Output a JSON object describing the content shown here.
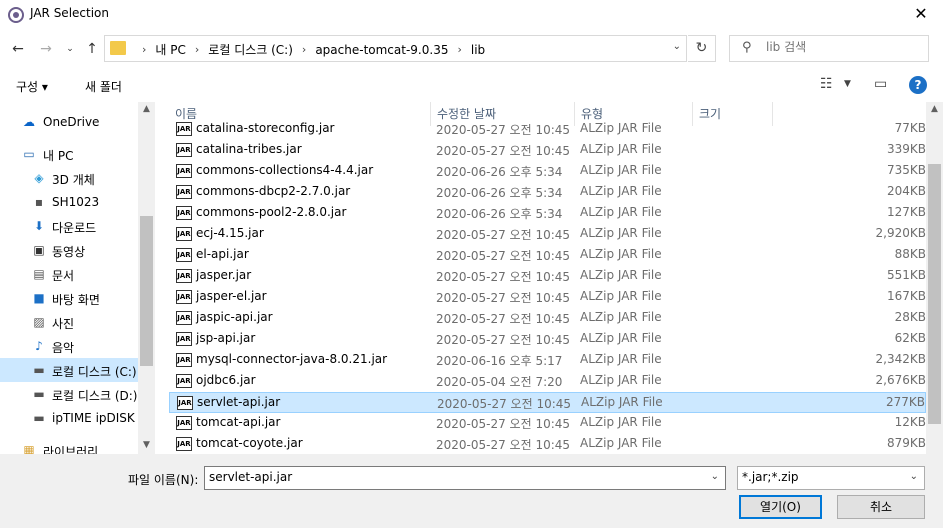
{
  "window": {
    "title": "JAR Selection"
  },
  "address": {
    "crumbs": [
      "내 PC",
      "로컬 디스크 (C:)",
      "apache-tomcat-9.0.35",
      "lib"
    ]
  },
  "search": {
    "placeholder": "lib 검색"
  },
  "toolbar": {
    "organize": "구성 ▾",
    "new_folder": "새 폴더"
  },
  "sidebar": {
    "items": [
      {
        "label": "OneDrive",
        "icon": "cloud-icon"
      },
      {
        "label": "내 PC",
        "icon": "computer-icon"
      },
      {
        "label": "3D 개체",
        "icon": "cube-icon"
      },
      {
        "label": "SH1023",
        "icon": "device-icon"
      },
      {
        "label": "다운로드",
        "icon": "download-icon"
      },
      {
        "label": "동영상",
        "icon": "video-icon"
      },
      {
        "label": "문서",
        "icon": "document-icon"
      },
      {
        "label": "바탕 화면",
        "icon": "desktop-icon"
      },
      {
        "label": "사진",
        "icon": "pictures-icon"
      },
      {
        "label": "음악",
        "icon": "music-icon"
      },
      {
        "label": "로컬 디스크 (C:)",
        "icon": "drive-icon"
      },
      {
        "label": "로컬 디스크 (D:)",
        "icon": "drive-icon"
      },
      {
        "label": "ipTIME ipDISK D",
        "icon": "drive-icon"
      },
      {
        "label": "라이브러리",
        "icon": "library-icon"
      }
    ]
  },
  "columns": {
    "name": "이름",
    "date": "수정한 날짜",
    "type": "유형",
    "size": "크기"
  },
  "files": [
    {
      "name": "catalina-storeconfig.jar",
      "date": "2020-05-27 오전 10:45",
      "type": "ALZip JAR File",
      "size": "77KB"
    },
    {
      "name": "catalina-tribes.jar",
      "date": "2020-05-27 오전 10:45",
      "type": "ALZip JAR File",
      "size": "339KB"
    },
    {
      "name": "commons-collections4-4.4.jar",
      "date": "2020-06-26 오후 5:34",
      "type": "ALZip JAR File",
      "size": "735KB"
    },
    {
      "name": "commons-dbcp2-2.7.0.jar",
      "date": "2020-06-26 오후 5:34",
      "type": "ALZip JAR File",
      "size": "204KB"
    },
    {
      "name": "commons-pool2-2.8.0.jar",
      "date": "2020-06-26 오후 5:34",
      "type": "ALZip JAR File",
      "size": "127KB"
    },
    {
      "name": "ecj-4.15.jar",
      "date": "2020-05-27 오전 10:45",
      "type": "ALZip JAR File",
      "size": "2,920KB"
    },
    {
      "name": "el-api.jar",
      "date": "2020-05-27 오전 10:45",
      "type": "ALZip JAR File",
      "size": "88KB"
    },
    {
      "name": "jasper.jar",
      "date": "2020-05-27 오전 10:45",
      "type": "ALZip JAR File",
      "size": "551KB"
    },
    {
      "name": "jasper-el.jar",
      "date": "2020-05-27 오전 10:45",
      "type": "ALZip JAR File",
      "size": "167KB"
    },
    {
      "name": "jaspic-api.jar",
      "date": "2020-05-27 오전 10:45",
      "type": "ALZip JAR File",
      "size": "28KB"
    },
    {
      "name": "jsp-api.jar",
      "date": "2020-05-27 오전 10:45",
      "type": "ALZip JAR File",
      "size": "62KB"
    },
    {
      "name": "mysql-connector-java-8.0.21.jar",
      "date": "2020-06-16 오후 5:17",
      "type": "ALZip JAR File",
      "size": "2,342KB"
    },
    {
      "name": "ojdbc6.jar",
      "date": "2020-05-04 오전 7:20",
      "type": "ALZip JAR File",
      "size": "2,676KB"
    },
    {
      "name": "servlet-api.jar",
      "date": "2020-05-27 오전 10:45",
      "type": "ALZip JAR File",
      "size": "277KB",
      "selected": true
    },
    {
      "name": "tomcat-api.jar",
      "date": "2020-05-27 오전 10:45",
      "type": "ALZip JAR File",
      "size": "12KB"
    },
    {
      "name": "tomcat-coyote.jar",
      "date": "2020-05-27 오전 10:45",
      "type": "ALZip JAR File",
      "size": "879KB"
    }
  ],
  "footer": {
    "filename_label": "파일 이름(N):",
    "filename_value": "servlet-api.jar",
    "filter_value": "*.jar;*.zip",
    "open_label": "열기(O)",
    "cancel_label": "취소"
  },
  "colors": {
    "selection": "#cce8ff",
    "accent": "#0078d7"
  }
}
